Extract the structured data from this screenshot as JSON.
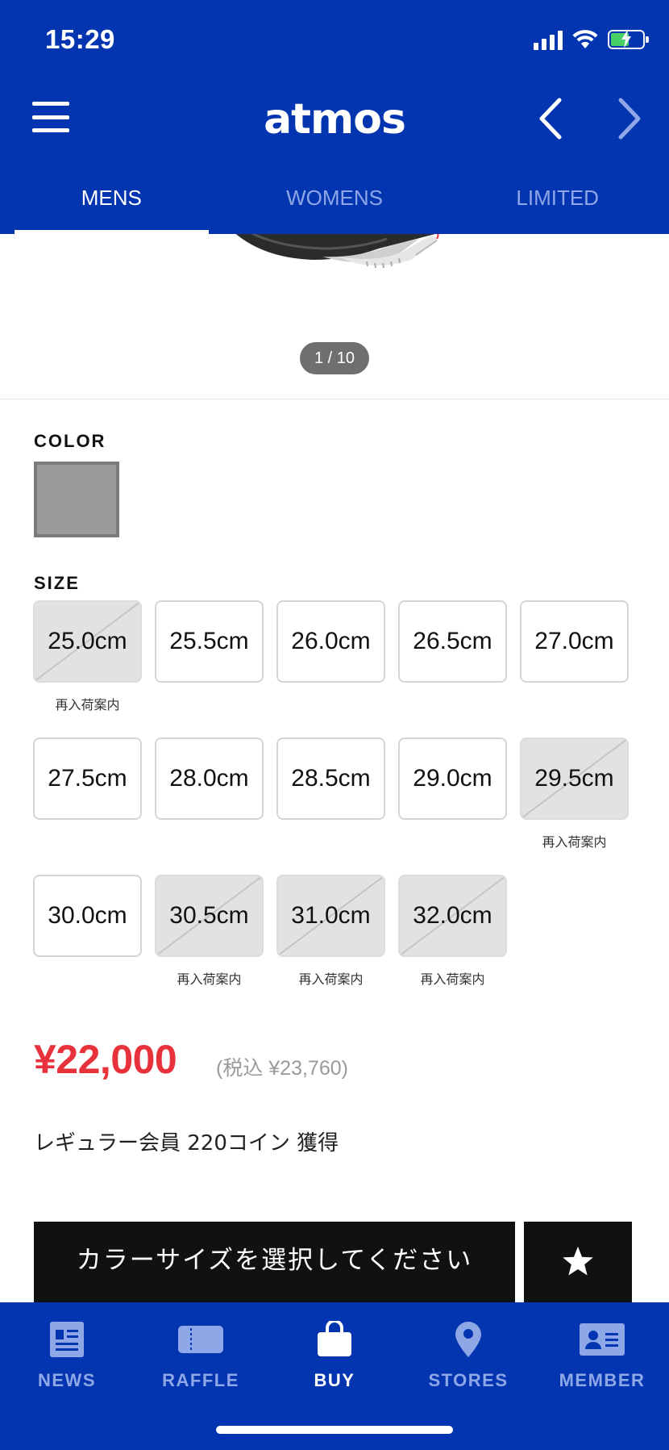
{
  "status_bar": {
    "time": "15:29"
  },
  "header": {
    "logo": "atmos"
  },
  "tabs": [
    {
      "label": "MENS",
      "active": true
    },
    {
      "label": "WOMENS",
      "active": false
    },
    {
      "label": "LIMITED",
      "active": false
    }
  ],
  "gallery": {
    "pager": "1 / 10"
  },
  "color": {
    "label": "COLOR",
    "selected_swatch": "#9b9b9b"
  },
  "size": {
    "label": "SIZE",
    "items": [
      {
        "label": "25.0cm",
        "available": false,
        "note": "再入荷案内"
      },
      {
        "label": "25.5cm",
        "available": true,
        "note": ""
      },
      {
        "label": "26.0cm",
        "available": true,
        "note": ""
      },
      {
        "label": "26.5cm",
        "available": true,
        "note": ""
      },
      {
        "label": "27.0cm",
        "available": true,
        "note": ""
      },
      {
        "label": "27.5cm",
        "available": true,
        "note": ""
      },
      {
        "label": "28.0cm",
        "available": true,
        "note": ""
      },
      {
        "label": "28.5cm",
        "available": true,
        "note": ""
      },
      {
        "label": "29.0cm",
        "available": true,
        "note": ""
      },
      {
        "label": "29.5cm",
        "available": false,
        "note": "再入荷案内"
      },
      {
        "label": "30.0cm",
        "available": true,
        "note": ""
      },
      {
        "label": "30.5cm",
        "available": false,
        "note": "再入荷案内"
      },
      {
        "label": "31.0cm",
        "available": false,
        "note": "再入荷案内"
      },
      {
        "label": "32.0cm",
        "available": false,
        "note": "再入荷案内"
      }
    ]
  },
  "price": {
    "main": "¥22,000",
    "tax_included": "(税込 ¥23,760)"
  },
  "coins": {
    "text": "レギュラー会員 220コイン 獲得"
  },
  "actions": {
    "select_label": "カラーサイズを選択してください"
  },
  "bottom_nav": [
    {
      "label": "NEWS",
      "icon": "news-icon",
      "active": false
    },
    {
      "label": "RAFFLE",
      "icon": "ticket-icon",
      "active": false
    },
    {
      "label": "BUY",
      "icon": "shopping-bag-icon",
      "active": true
    },
    {
      "label": "STORES",
      "icon": "location-pin-icon",
      "active": false
    },
    {
      "label": "MEMBER",
      "icon": "member-card-icon",
      "active": false
    }
  ],
  "colors": {
    "brand_blue": "#0435b0",
    "price_red": "#e8323b",
    "inactive_blue": "#8ea7e6"
  }
}
